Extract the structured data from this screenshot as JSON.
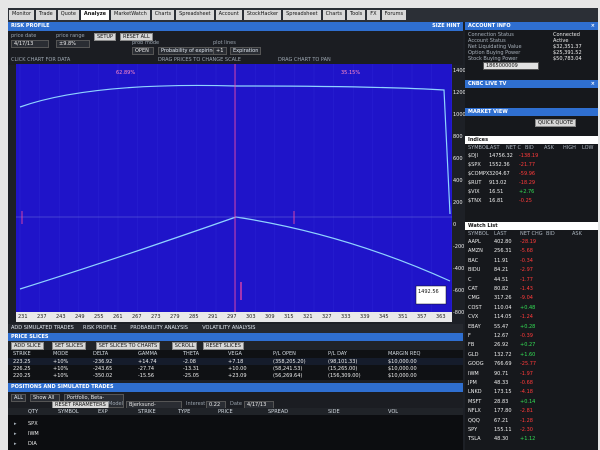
{
  "menu": {
    "tabs": [
      "Monitor",
      "Trade",
      "Quote",
      "Analyze",
      "MarketWatch",
      "Charts",
      "Spreadsheet",
      "Account",
      "StockHacker",
      "Spreadsheet",
      "Charts",
      "Tools",
      "FX",
      "Forums"
    ],
    "active": "Analyze"
  },
  "risk_profile": {
    "title": "RISK PROFILE",
    "right_title": "SIZE HINT",
    "controls": {
      "price_date_label": "price date",
      "price_date_value": "4/17/13",
      "price_range_label": "price range",
      "price_range_value": "±9.8%",
      "prob_mode_label": "prob mode",
      "prob_mode_value": "OPEN",
      "prob_mode_btn": "Probability of expiring",
      "plot_lines_label": "plot lines",
      "plot_lines_value": "+1",
      "plot_lines_btn": "Expiration",
      "setup_btn": "SETUP",
      "reset_btn": "RESET ALL",
      "click_hint": "CLICK CHART FOR DATA",
      "drag_hint": "DRAG PRICES TO CHANGE SCALE",
      "drag_pan": "DRAG CHART TO PAN"
    },
    "chart_labels": {
      "underlying_price": "1492.56",
      "top_label_left": "62.89%",
      "top_label_right": "35.15%",
      "y_top": "1400",
      "y_ticks": [
        "1400",
        "1200",
        "1000",
        "800",
        "600",
        "400",
        "200",
        "0",
        "-200",
        "-400",
        "-600",
        "-800"
      ],
      "x_ticks": [
        "231",
        "237",
        "243",
        "249",
        "255",
        "261",
        "267",
        "273",
        "279",
        "285",
        "291",
        "297",
        "303",
        "309",
        "315",
        "321",
        "327",
        "333",
        "339",
        "345",
        "351",
        "357",
        "363"
      ]
    }
  },
  "subtabs": [
    "ADD SIMULATED TRADES",
    "RISK PROFILE",
    "PROBABILITY ANALYSIS",
    "VOLATILITY ANALYSIS"
  ],
  "price_slices": {
    "title": "PRICE SLICES",
    "buttons": [
      "ADD SLICE",
      "SET SLICES",
      "SET SLICES TO CHARTS",
      "SCROLL",
      "RESET SLICES"
    ],
    "columns": [
      "STRIKE",
      "MODE",
      "DELTA",
      "GAMMA",
      "THETA",
      "VEGA",
      "P/L OPEN",
      "P/L DAY",
      "MARGIN REQ"
    ],
    "rows": [
      [
        "223.25",
        "+10%",
        "-236.92",
        "+14.74",
        "-2.08",
        "+7.18",
        "(358,205.20)",
        "(98,101.33)",
        "$10,000.00"
      ],
      [
        "226.25",
        "+10%",
        "-243.65",
        "-27.74",
        "-13.31",
        "+10.00",
        "(58,241.53)",
        "(15,265.00)",
        "$10,000.00"
      ],
      [
        "220.25",
        "+10%",
        "-350.02",
        "-15.56",
        "-25.05",
        "+23.09",
        "(56,269.64)",
        "(156,309.00)",
        "$10,000.00"
      ]
    ]
  },
  "positions": {
    "title": "POSITIONS AND SIMULATED TRADES",
    "controls": {
      "group_label": "ALL",
      "show_label": "Show All",
      "beta_label": "Portfolio, Beta-Weighted",
      "reset_btn": "RESET PARAMETERS",
      "model_label": "Model",
      "model_value": "Bjerksund-Stensland",
      "interest_label": "Interest",
      "interest_value": "0.22",
      "date_label": "Date",
      "date_value": "4/17/13"
    },
    "columns": [
      "QTY",
      "SYMBOL",
      "EXP",
      "STRIKE",
      "TYPE",
      "PRICE",
      "SPREAD",
      "SIDE",
      "VOL"
    ],
    "rows": [
      "SPX",
      "IWM",
      "DIA",
      "SPY"
    ]
  },
  "account_info": {
    "title": "ACCOUNT INFO",
    "fields": [
      {
        "label": "Connection Status",
        "value": "Connected"
      },
      {
        "label": "Account Status",
        "value": "Active"
      },
      {
        "label": "Net Liquidating Value",
        "value": "$32,351.37"
      },
      {
        "label": "Option Buying Power",
        "value": "$25,391.52"
      },
      {
        "label": "Stock Buying Power",
        "value": "$50,783.04"
      }
    ],
    "account_number": "1865000009"
  },
  "live_tv": {
    "title": "CNBC LIVE TV"
  },
  "market_view": {
    "title": "MARKET VIEW",
    "btn": "QUICK QUOTE"
  },
  "quote_watch": {
    "title": "Indices",
    "columns": [
      "SYMBOL",
      "LAST",
      "NET C",
      "BID",
      "ASK",
      "HIGH",
      "LOW"
    ],
    "rows": [
      {
        "sym": "$DJI",
        "last": "14756.32",
        "net": "-138.19",
        "c": "red"
      },
      {
        "sym": "$SPX",
        "last": "1552.36",
        "net": "-21.77",
        "c": "red"
      },
      {
        "sym": "$COMPX",
        "last": "3204.67",
        "net": "-59.96",
        "c": "red"
      },
      {
        "sym": "$RUT",
        "last": "913.02",
        "net": "-18.29",
        "c": "red"
      },
      {
        "sym": "$VIX",
        "last": "16.51",
        "net": "+2.76",
        "c": "green"
      },
      {
        "sym": "$TNX",
        "last": "16.81",
        "net": "-0.25",
        "c": "red"
      }
    ]
  },
  "watch_list": {
    "title": "Watch List",
    "columns": [
      "SYMBOL",
      "LAST",
      "NET CHG",
      "BID",
      "ASK"
    ],
    "rows": [
      {
        "sym": "AAPL",
        "last": "402.80",
        "net": "-28.19",
        "c": "red"
      },
      {
        "sym": "AMZN",
        "last": "256.31",
        "net": "-5.68",
        "c": "red"
      },
      {
        "sym": "BAC",
        "last": "11.91",
        "net": "-0.34",
        "c": "red"
      },
      {
        "sym": "BIDU",
        "last": "84.21",
        "net": "-2.97",
        "c": "red"
      },
      {
        "sym": "C",
        "last": "44.51",
        "net": "-1.77",
        "c": "red"
      },
      {
        "sym": "CAT",
        "last": "80.82",
        "net": "-1.43",
        "c": "red"
      },
      {
        "sym": "CMG",
        "last": "317.26",
        "net": "-9.04",
        "c": "red"
      },
      {
        "sym": "COST",
        "last": "110.04",
        "net": "+0.48",
        "c": "green"
      },
      {
        "sym": "CVX",
        "last": "114.05",
        "net": "-1.24",
        "c": "red"
      },
      {
        "sym": "EBAY",
        "last": "55.47",
        "net": "+0.28",
        "c": "green"
      },
      {
        "sym": "F",
        "last": "12.67",
        "net": "-0.39",
        "c": "red"
      },
      {
        "sym": "FB",
        "last": "26.92",
        "net": "+0.27",
        "c": "green"
      },
      {
        "sym": "GLD",
        "last": "132.72",
        "net": "+1.60",
        "c": "green"
      },
      {
        "sym": "GOOG",
        "last": "766.69",
        "net": "-25.77",
        "c": "red"
      },
      {
        "sym": "IWM",
        "last": "90.71",
        "net": "-1.97",
        "c": "red"
      },
      {
        "sym": "JPM",
        "last": "48.33",
        "net": "-0.68",
        "c": "red"
      },
      {
        "sym": "LNKD",
        "last": "173.15",
        "net": "-4.18",
        "c": "red"
      },
      {
        "sym": "MSFT",
        "last": "28.83",
        "net": "+0.14",
        "c": "green"
      },
      {
        "sym": "NFLX",
        "last": "177.80",
        "net": "-2.81",
        "c": "red"
      },
      {
        "sym": "QQQ",
        "last": "67.21",
        "net": "-1.28",
        "c": "red"
      },
      {
        "sym": "SPY",
        "last": "155.11",
        "net": "-2.30",
        "c": "red"
      },
      {
        "sym": "TSLA",
        "last": "48.30",
        "net": "+1.12",
        "c": "green"
      }
    ]
  },
  "colors": {
    "chart_bg": "#1f14c9",
    "curve": "#8fd3ff",
    "accent": "#ff4aa0",
    "title": "#2f6fd0"
  }
}
